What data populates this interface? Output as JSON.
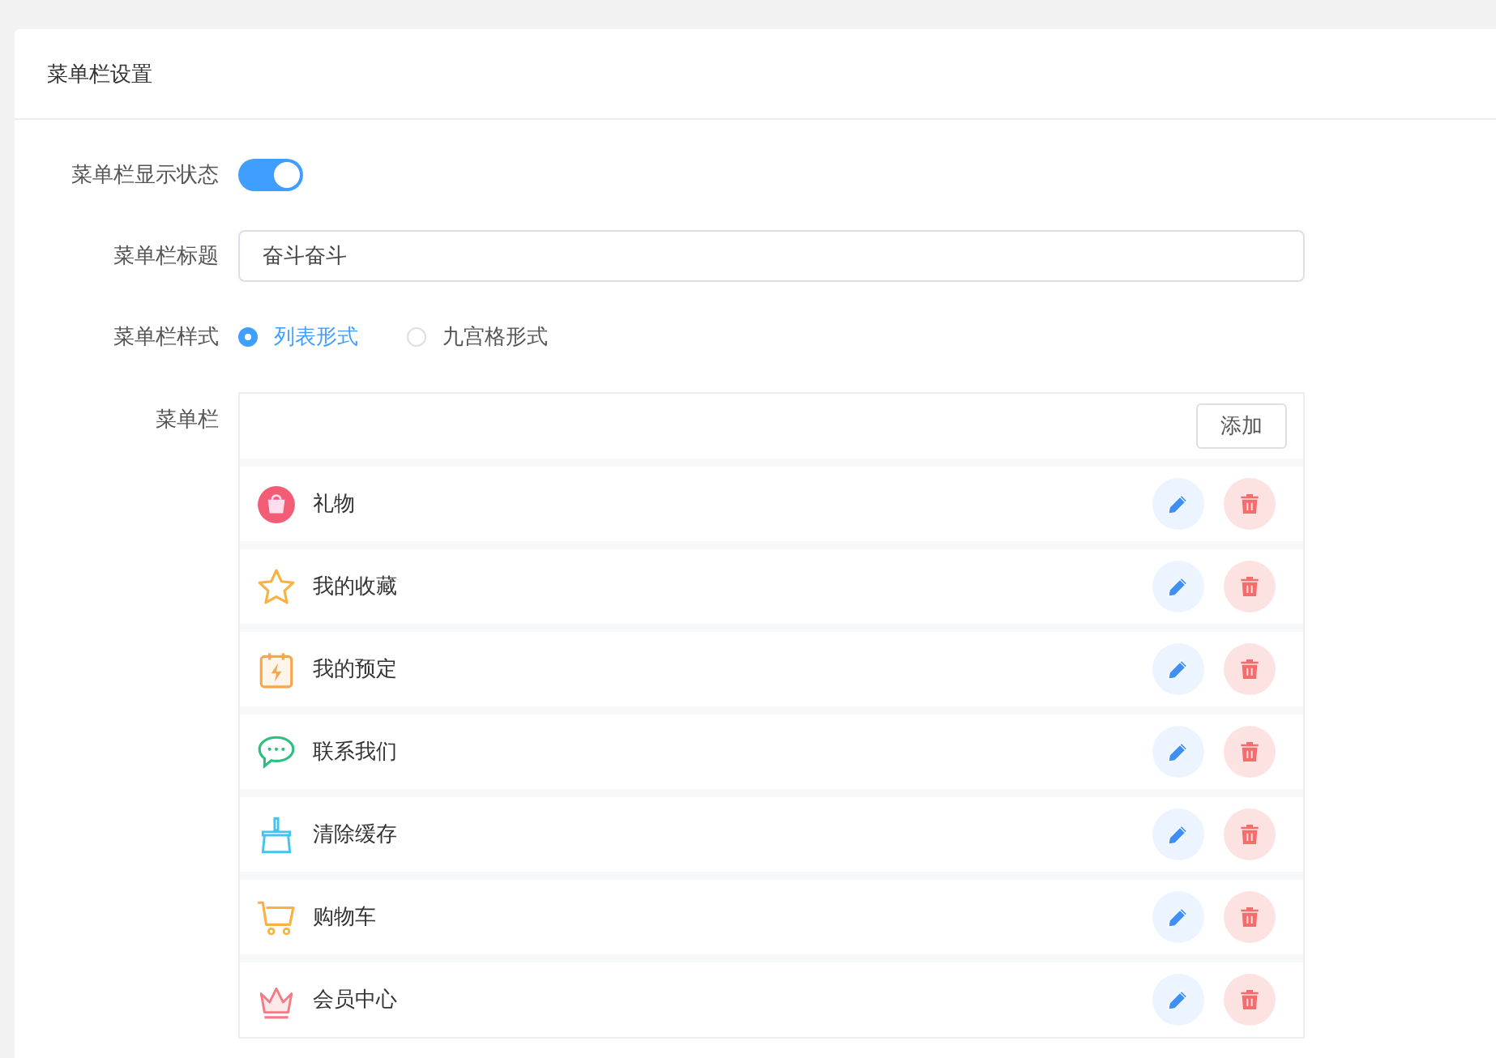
{
  "card": {
    "title": "菜单栏设置"
  },
  "form": {
    "display_label": "菜单栏显示状态",
    "display_on": true,
    "title_label": "菜单栏标题",
    "title_value": "奋斗奋斗",
    "style_label": "菜单栏样式",
    "style_options": [
      {
        "label": "列表形式",
        "selected": true
      },
      {
        "label": "九宫格形式",
        "selected": false
      }
    ],
    "menu_label": "菜单栏",
    "add_button": "添加",
    "menu_items": [
      {
        "label": "礼物",
        "kind": "gift"
      },
      {
        "label": "我的收藏",
        "kind": "star"
      },
      {
        "label": "我的预定",
        "kind": "calendar"
      },
      {
        "label": "联系我们",
        "kind": "chat"
      },
      {
        "label": "清除缓存",
        "kind": "broom"
      },
      {
        "label": "购物车",
        "kind": "cart"
      },
      {
        "label": "会员中心",
        "kind": "crown"
      }
    ]
  }
}
